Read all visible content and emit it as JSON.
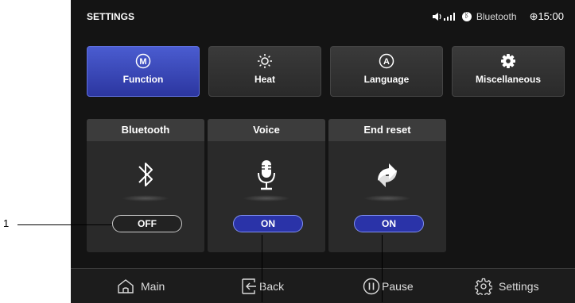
{
  "status": {
    "title": "SETTINGS",
    "bluetooth_label": "Bluetooth",
    "time": "⊕15:00"
  },
  "tabs": [
    {
      "label": "Function",
      "glyph": "M",
      "icon": "function-icon",
      "active": true
    },
    {
      "label": "Heat",
      "glyph": "",
      "icon": "sun-icon",
      "active": false
    },
    {
      "label": "Language",
      "glyph": "A",
      "icon": "language-icon",
      "active": false
    },
    {
      "label": "Miscellaneous",
      "glyph": "",
      "icon": "gear-icon",
      "active": false
    }
  ],
  "cards": [
    {
      "title": "Bluetooth",
      "state": "OFF",
      "icon": "bluetooth-icon"
    },
    {
      "title": "Voice",
      "state": "ON",
      "icon": "microphone-icon"
    },
    {
      "title": "End reset",
      "state": "ON",
      "icon": "reset-icon"
    }
  ],
  "nav": [
    {
      "label": "Main",
      "icon": "home-icon"
    },
    {
      "label": "Back",
      "icon": "back-icon"
    },
    {
      "label": "Pause",
      "icon": "pause-icon"
    },
    {
      "label": "Settings",
      "icon": "settings-icon"
    }
  ],
  "callout": {
    "number": "1"
  },
  "colors": {
    "accent": "#3a46c4",
    "background": "#141414",
    "card": "#2a2a2a"
  }
}
